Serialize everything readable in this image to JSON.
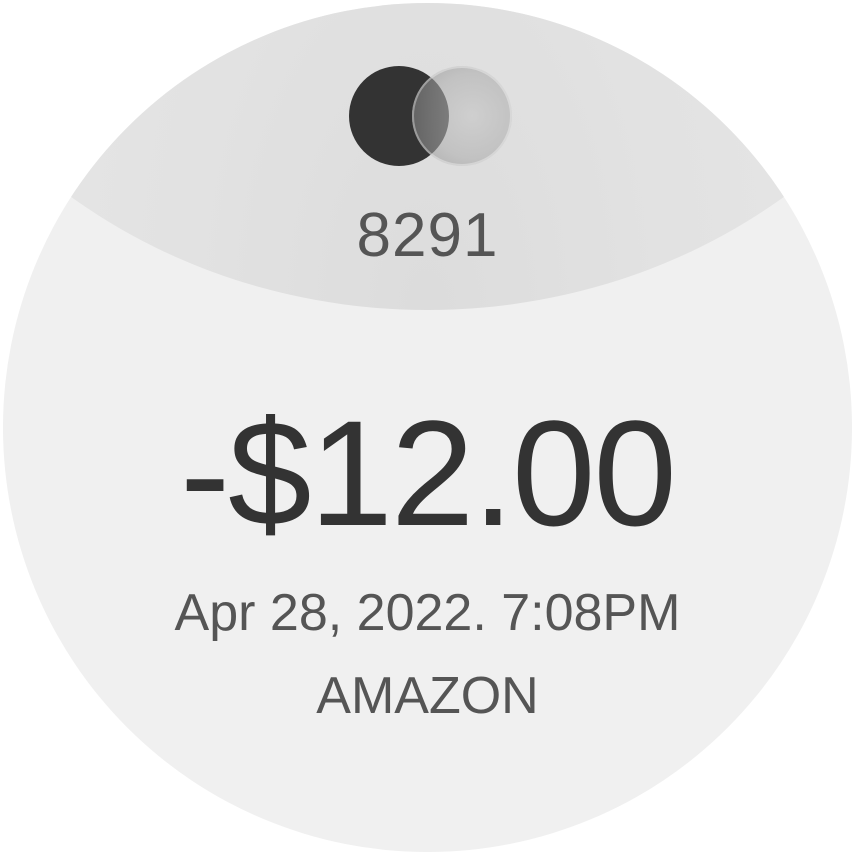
{
  "card": {
    "icon": "card-network-logo-icon",
    "last4": "8291"
  },
  "transaction": {
    "amount": "-$12.00",
    "datetime": "Apr 28, 2022. 7:08PM",
    "merchant": "AMAZON"
  },
  "colors": {
    "face_background": "#f0f0f0",
    "top_cap": "#e4e4e4",
    "primary_text": "#333333",
    "secondary_text": "#555555",
    "logo_dark": "#333333",
    "logo_light": "#c4c4c4"
  }
}
